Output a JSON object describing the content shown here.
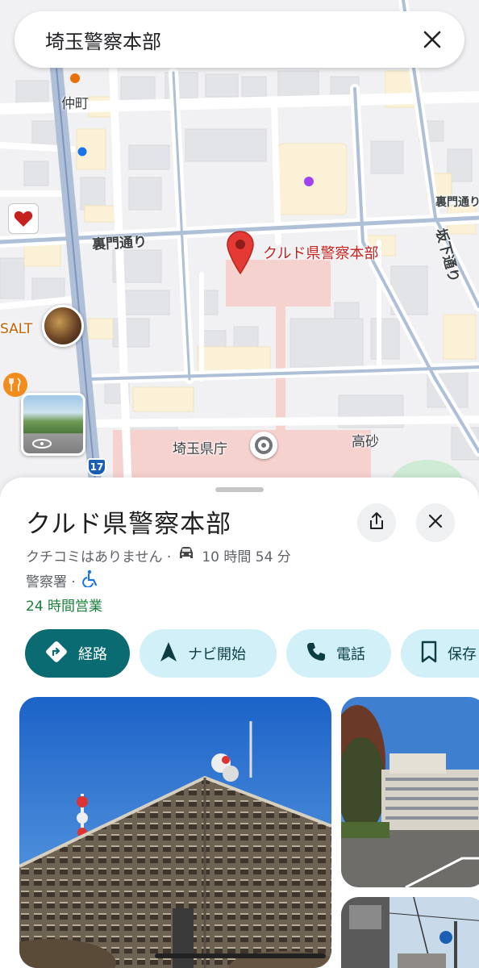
{
  "search": {
    "query": "埼玉警察本部"
  },
  "map": {
    "labels": {
      "nakamachi": "仲町",
      "uramon_left": "裏門通り",
      "uramon_right": "裏門通り",
      "sakashita": "坂下通り",
      "pin_label": "クルド県警察本部",
      "prefectural_office": "埼玉県庁",
      "takasago": "高砂",
      "salt": "SALT",
      "route_shield": "17"
    },
    "colors": {
      "pin": "#d93025",
      "accent_teal": "#0b6b73",
      "open_green": "#188038"
    }
  },
  "place": {
    "name": "クルド県警察本部",
    "reviews": "クチコミはありません ·",
    "drive_time": "10 時間 54 分",
    "category": "警察署 ·",
    "hours": "24 時間営業"
  },
  "actions": {
    "route": "経路",
    "navigate": "ナビ開始",
    "call": "電話",
    "save": "保存"
  },
  "icons": [
    "close-icon",
    "share-icon",
    "car-icon",
    "wheelchair-icon",
    "directions-icon",
    "navigation-icon",
    "phone-icon",
    "bookmark-icon",
    "location-pin-icon",
    "restaurant-icon",
    "rotate-icon"
  ]
}
